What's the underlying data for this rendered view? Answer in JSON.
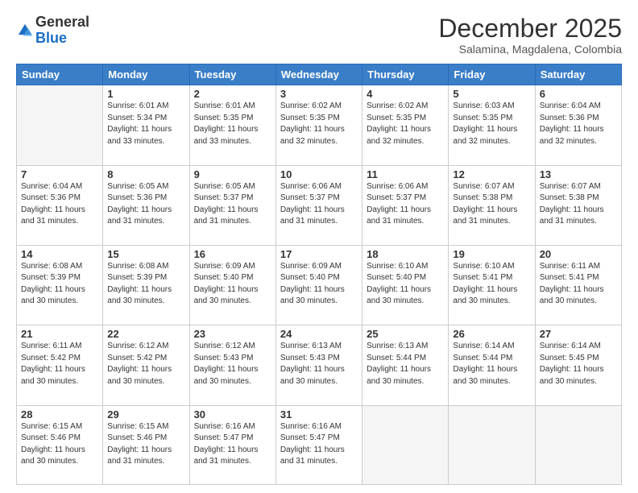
{
  "logo": {
    "general": "General",
    "blue": "Blue"
  },
  "title": "December 2025",
  "location": "Salamina, Magdalena, Colombia",
  "days_header": [
    "Sunday",
    "Monday",
    "Tuesday",
    "Wednesday",
    "Thursday",
    "Friday",
    "Saturday"
  ],
  "weeks": [
    [
      {
        "day": "",
        "sunrise": "",
        "sunset": "",
        "daylight": "",
        "empty": true
      },
      {
        "day": "1",
        "sunrise": "Sunrise: 6:01 AM",
        "sunset": "Sunset: 5:34 PM",
        "daylight": "Daylight: 11 hours and 33 minutes."
      },
      {
        "day": "2",
        "sunrise": "Sunrise: 6:01 AM",
        "sunset": "Sunset: 5:35 PM",
        "daylight": "Daylight: 11 hours and 33 minutes."
      },
      {
        "day": "3",
        "sunrise": "Sunrise: 6:02 AM",
        "sunset": "Sunset: 5:35 PM",
        "daylight": "Daylight: 11 hours and 32 minutes."
      },
      {
        "day": "4",
        "sunrise": "Sunrise: 6:02 AM",
        "sunset": "Sunset: 5:35 PM",
        "daylight": "Daylight: 11 hours and 32 minutes."
      },
      {
        "day": "5",
        "sunrise": "Sunrise: 6:03 AM",
        "sunset": "Sunset: 5:35 PM",
        "daylight": "Daylight: 11 hours and 32 minutes."
      },
      {
        "day": "6",
        "sunrise": "Sunrise: 6:04 AM",
        "sunset": "Sunset: 5:36 PM",
        "daylight": "Daylight: 11 hours and 32 minutes."
      }
    ],
    [
      {
        "day": "7",
        "sunrise": "Sunrise: 6:04 AM",
        "sunset": "Sunset: 5:36 PM",
        "daylight": "Daylight: 11 hours and 31 minutes."
      },
      {
        "day": "8",
        "sunrise": "Sunrise: 6:05 AM",
        "sunset": "Sunset: 5:36 PM",
        "daylight": "Daylight: 11 hours and 31 minutes."
      },
      {
        "day": "9",
        "sunrise": "Sunrise: 6:05 AM",
        "sunset": "Sunset: 5:37 PM",
        "daylight": "Daylight: 11 hours and 31 minutes."
      },
      {
        "day": "10",
        "sunrise": "Sunrise: 6:06 AM",
        "sunset": "Sunset: 5:37 PM",
        "daylight": "Daylight: 11 hours and 31 minutes."
      },
      {
        "day": "11",
        "sunrise": "Sunrise: 6:06 AM",
        "sunset": "Sunset: 5:37 PM",
        "daylight": "Daylight: 11 hours and 31 minutes."
      },
      {
        "day": "12",
        "sunrise": "Sunrise: 6:07 AM",
        "sunset": "Sunset: 5:38 PM",
        "daylight": "Daylight: 11 hours and 31 minutes."
      },
      {
        "day": "13",
        "sunrise": "Sunrise: 6:07 AM",
        "sunset": "Sunset: 5:38 PM",
        "daylight": "Daylight: 11 hours and 31 minutes."
      }
    ],
    [
      {
        "day": "14",
        "sunrise": "Sunrise: 6:08 AM",
        "sunset": "Sunset: 5:39 PM",
        "daylight": "Daylight: 11 hours and 30 minutes."
      },
      {
        "day": "15",
        "sunrise": "Sunrise: 6:08 AM",
        "sunset": "Sunset: 5:39 PM",
        "daylight": "Daylight: 11 hours and 30 minutes."
      },
      {
        "day": "16",
        "sunrise": "Sunrise: 6:09 AM",
        "sunset": "Sunset: 5:40 PM",
        "daylight": "Daylight: 11 hours and 30 minutes."
      },
      {
        "day": "17",
        "sunrise": "Sunrise: 6:09 AM",
        "sunset": "Sunset: 5:40 PM",
        "daylight": "Daylight: 11 hours and 30 minutes."
      },
      {
        "day": "18",
        "sunrise": "Sunrise: 6:10 AM",
        "sunset": "Sunset: 5:40 PM",
        "daylight": "Daylight: 11 hours and 30 minutes."
      },
      {
        "day": "19",
        "sunrise": "Sunrise: 6:10 AM",
        "sunset": "Sunset: 5:41 PM",
        "daylight": "Daylight: 11 hours and 30 minutes."
      },
      {
        "day": "20",
        "sunrise": "Sunrise: 6:11 AM",
        "sunset": "Sunset: 5:41 PM",
        "daylight": "Daylight: 11 hours and 30 minutes."
      }
    ],
    [
      {
        "day": "21",
        "sunrise": "Sunrise: 6:11 AM",
        "sunset": "Sunset: 5:42 PM",
        "daylight": "Daylight: 11 hours and 30 minutes."
      },
      {
        "day": "22",
        "sunrise": "Sunrise: 6:12 AM",
        "sunset": "Sunset: 5:42 PM",
        "daylight": "Daylight: 11 hours and 30 minutes."
      },
      {
        "day": "23",
        "sunrise": "Sunrise: 6:12 AM",
        "sunset": "Sunset: 5:43 PM",
        "daylight": "Daylight: 11 hours and 30 minutes."
      },
      {
        "day": "24",
        "sunrise": "Sunrise: 6:13 AM",
        "sunset": "Sunset: 5:43 PM",
        "daylight": "Daylight: 11 hours and 30 minutes."
      },
      {
        "day": "25",
        "sunrise": "Sunrise: 6:13 AM",
        "sunset": "Sunset: 5:44 PM",
        "daylight": "Daylight: 11 hours and 30 minutes."
      },
      {
        "day": "26",
        "sunrise": "Sunrise: 6:14 AM",
        "sunset": "Sunset: 5:44 PM",
        "daylight": "Daylight: 11 hours and 30 minutes."
      },
      {
        "day": "27",
        "sunrise": "Sunrise: 6:14 AM",
        "sunset": "Sunset: 5:45 PM",
        "daylight": "Daylight: 11 hours and 30 minutes."
      }
    ],
    [
      {
        "day": "28",
        "sunrise": "Sunrise: 6:15 AM",
        "sunset": "Sunset: 5:46 PM",
        "daylight": "Daylight: 11 hours and 30 minutes."
      },
      {
        "day": "29",
        "sunrise": "Sunrise: 6:15 AM",
        "sunset": "Sunset: 5:46 PM",
        "daylight": "Daylight: 11 hours and 31 minutes."
      },
      {
        "day": "30",
        "sunrise": "Sunrise: 6:16 AM",
        "sunset": "Sunset: 5:47 PM",
        "daylight": "Daylight: 11 hours and 31 minutes."
      },
      {
        "day": "31",
        "sunrise": "Sunrise: 6:16 AM",
        "sunset": "Sunset: 5:47 PM",
        "daylight": "Daylight: 11 hours and 31 minutes."
      },
      {
        "day": "",
        "sunrise": "",
        "sunset": "",
        "daylight": "",
        "empty": true
      },
      {
        "day": "",
        "sunrise": "",
        "sunset": "",
        "daylight": "",
        "empty": true
      },
      {
        "day": "",
        "sunrise": "",
        "sunset": "",
        "daylight": "",
        "empty": true
      }
    ]
  ]
}
